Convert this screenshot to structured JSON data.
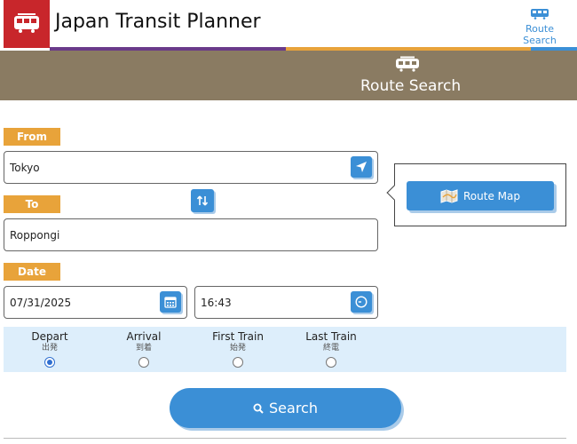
{
  "header": {
    "app_title": "Japan Transit Planner",
    "nav_route_search": "Route Search"
  },
  "banner": {
    "title": "Route Search"
  },
  "form": {
    "from_label": "From",
    "from_value": "Tokyo",
    "to_label": "To",
    "to_value": "Roppongi",
    "date_label": "Date",
    "date_value": "07/31/2025",
    "time_value": "16:43"
  },
  "route_map": {
    "label": "Route Map"
  },
  "options": [
    {
      "label": "Depart",
      "sub": "出発",
      "checked": true
    },
    {
      "label": "Arrival",
      "sub": "到着",
      "checked": false
    },
    {
      "label": "First Train",
      "sub": "始発",
      "checked": false
    },
    {
      "label": "Last Train",
      "sub": "終電",
      "checked": false
    }
  ],
  "search": {
    "label": "Search"
  },
  "colors": {
    "brand_red": "#c8262b",
    "accent_blue": "#3b8fd6",
    "label_orange": "#e8a33a",
    "banner_brown": "#8a7b62",
    "options_bg": "#ddeefb"
  }
}
